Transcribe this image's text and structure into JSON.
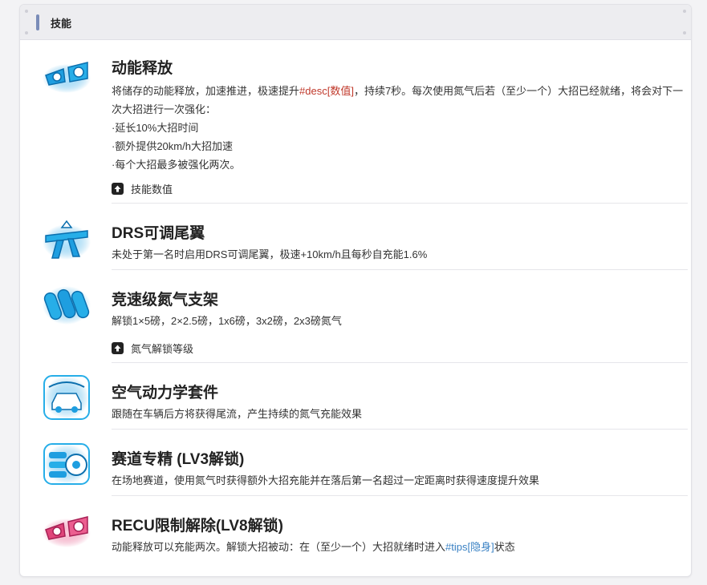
{
  "header": {
    "title": "技能"
  },
  "skills": [
    {
      "name": "动能释放",
      "desc_pre": "将储存的动能释放，加速推进，极速提升",
      "desc_hl": "#desc[数值]",
      "desc_post": "，持续7秒。每次使用氮气后若（至少一个）大招已经就绪，将会对下一次大招进行一次强化：",
      "bullets": [
        "·延长10%大招时间",
        "·额外提供20km/h大招加速",
        "·每个大招最多被强化两次。"
      ],
      "expand_label": "技能数值",
      "icon": "twin-thruster-icon",
      "color": "#1e9ee0"
    },
    {
      "name": "DRS可调尾翼",
      "desc": "未处于第一名时启用DRS可调尾翼，极速+10km/h且每秒自充能1.6%",
      "icon": "rear-wing-icon",
      "color": "#1e9ee0"
    },
    {
      "name": "竞速级氮气支架",
      "desc": "解锁1×5磅，2×2.5磅，1x6磅，3x2磅，2x3磅氮气",
      "expand_label": "氮气解锁等级",
      "icon": "nitro-tanks-icon",
      "color": "#1e9ee0"
    },
    {
      "name": "空气动力学套件",
      "desc": "跟随在车辆后方将获得尾流，产生持续的氮气充能效果",
      "icon": "aero-car-icon",
      "color": "#1e9ee0"
    },
    {
      "name": "赛道专精 (LV3解锁)",
      "desc": "在场地赛道，使用氮气时获得额外大招充能并在落后第一名超过一定距离时获得速度提升效果",
      "icon": "tire-icon",
      "color": "#1e9ee0"
    },
    {
      "name": "RECU限制解除(LV8解锁)",
      "desc_pre": "动能释放可以充能两次。解锁大招被动：在（至少一个）大招就绪时进入",
      "desc_hl": "#tips[隐身]",
      "desc_post": "状态",
      "icon": "twin-thruster-red-icon",
      "color": "#e0457a"
    }
  ]
}
